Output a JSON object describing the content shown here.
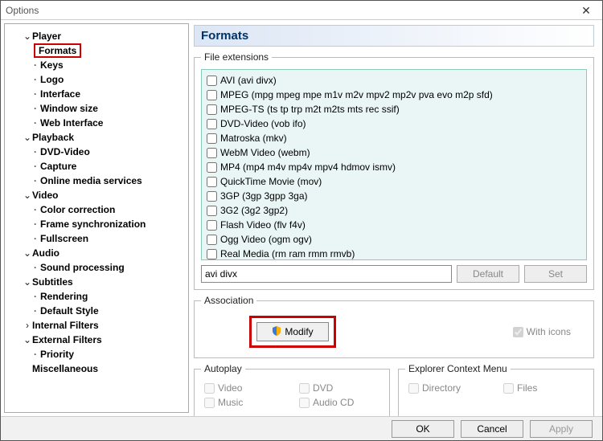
{
  "title": "Options",
  "header": "Formats",
  "tree": {
    "player": {
      "label": "Player",
      "children": [
        "Formats",
        "Keys",
        "Logo",
        "Interface",
        "Window size",
        "Web Interface"
      ]
    },
    "playback": {
      "label": "Playback",
      "children": [
        "DVD-Video",
        "Capture",
        "Online media services"
      ]
    },
    "video": {
      "label": "Video",
      "children": [
        "Color correction",
        "Frame synchronization",
        "Fullscreen"
      ]
    },
    "audio": {
      "label": "Audio",
      "children": [
        "Sound processing"
      ]
    },
    "subtitles": {
      "label": "Subtitles",
      "children": [
        "Rendering",
        "Default Style"
      ]
    },
    "internal": {
      "label": "Internal Filters"
    },
    "external": {
      "label": "External Filters",
      "children": [
        "Priority"
      ]
    },
    "misc": {
      "label": "Miscellaneous"
    }
  },
  "fileext_legend": "File extensions",
  "formats": [
    "AVI (avi divx)",
    "MPEG (mpg mpeg mpe m1v m2v mpv2 mp2v pva evo m2p sfd)",
    "MPEG-TS (ts tp trp m2t m2ts mts rec ssif)",
    "DVD-Video (vob ifo)",
    "Matroska (mkv)",
    "WebM Video (webm)",
    "MP4 (mp4 m4v mp4v mpv4 hdmov ismv)",
    "QuickTime Movie (mov)",
    "3GP (3gp 3gpp 3ga)",
    "3G2 (3g2 3gp2)",
    "Flash Video (flv f4v)",
    "Ogg Video (ogm ogv)",
    "Real Media (rm ram rmm rmvb)"
  ],
  "ext_input": "avi divx",
  "btn_default": "Default",
  "btn_set": "Set",
  "assoc_legend": "Association",
  "btn_modify": "Modify",
  "with_icons": "With icons",
  "autoplay_legend": "Autoplay",
  "autoplay": [
    "Video",
    "DVD",
    "Music",
    "Audio CD"
  ],
  "ctx_legend": "Explorer Context Menu",
  "ctx": [
    "Directory",
    "Files"
  ],
  "btn_ok": "OK",
  "btn_cancel": "Cancel",
  "btn_apply": "Apply"
}
